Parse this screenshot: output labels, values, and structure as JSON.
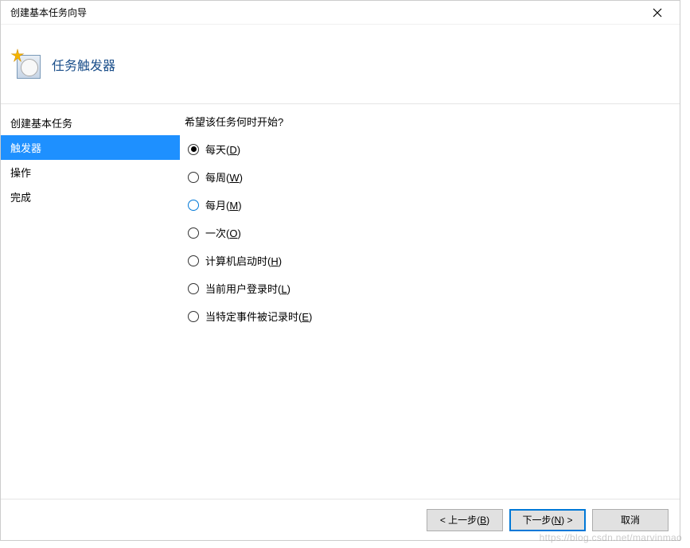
{
  "window": {
    "title": "创建基本任务向导"
  },
  "header": {
    "page_title": "任务触发器"
  },
  "sidebar": {
    "items": [
      {
        "label": "创建基本任务",
        "selected": false
      },
      {
        "label": "触发器",
        "selected": true
      },
      {
        "label": "操作",
        "selected": false
      },
      {
        "label": "完成",
        "selected": false
      }
    ]
  },
  "content": {
    "prompt": "希望该任务何时开始?",
    "options": [
      {
        "label_pre": "每天(",
        "accel": "D",
        "label_post": ")",
        "checked": true,
        "hover": false
      },
      {
        "label_pre": "每周(",
        "accel": "W",
        "label_post": ")",
        "checked": false,
        "hover": false
      },
      {
        "label_pre": "每月(",
        "accel": "M",
        "label_post": ")",
        "checked": false,
        "hover": true
      },
      {
        "label_pre": "一次(",
        "accel": "O",
        "label_post": ")",
        "checked": false,
        "hover": false
      },
      {
        "label_pre": "计算机启动时(",
        "accel": "H",
        "label_post": ")",
        "checked": false,
        "hover": false
      },
      {
        "label_pre": "当前用户登录时(",
        "accel": "L",
        "label_post": ")",
        "checked": false,
        "hover": false
      },
      {
        "label_pre": "当特定事件被记录时(",
        "accel": "E",
        "label_post": ")",
        "checked": false,
        "hover": false
      }
    ]
  },
  "footer": {
    "back_pre": "< 上一步(",
    "back_accel": "B",
    "back_post": ")",
    "next_pre": "下一步(",
    "next_accel": "N",
    "next_post": ") >",
    "cancel": "取消"
  },
  "watermark": "https://blog.csdn.net/marvinmao"
}
